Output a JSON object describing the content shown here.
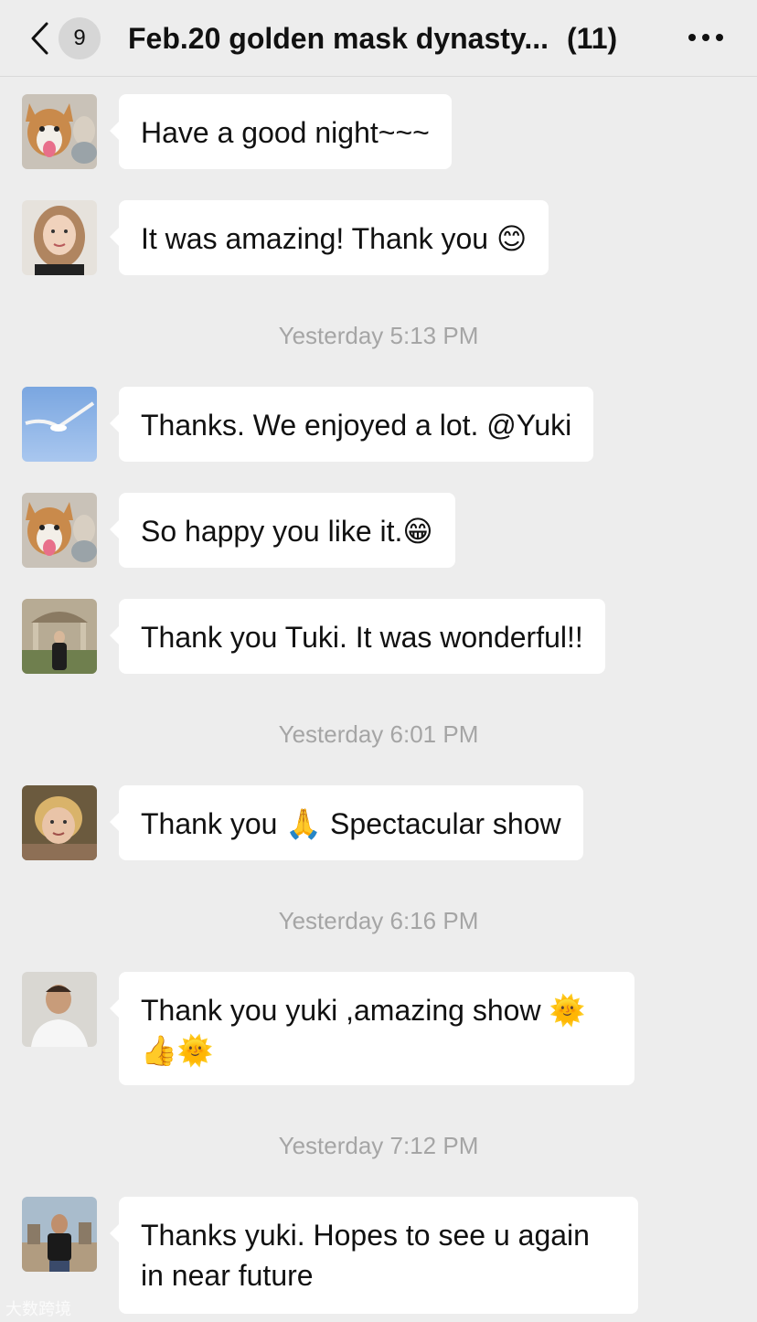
{
  "header": {
    "unread_count": "9",
    "title": "Feb.20 golden mask dynasty...",
    "member_count": "(11)"
  },
  "messages": [
    {
      "avatar": "corgi-dog-avatar",
      "text": "Have a good night~~~",
      "emoji": ""
    },
    {
      "avatar": "woman-portrait-avatar",
      "text": "It was amazing! Thank you ",
      "emoji": "😊"
    },
    {
      "avatar": "seagull-sky-avatar",
      "text": "Thanks. We enjoyed a lot. @Yuki",
      "emoji": ""
    },
    {
      "avatar": "corgi-dog-avatar",
      "text": "So happy you like it.",
      "emoji": "😁"
    },
    {
      "avatar": "person-pavilion-avatar",
      "text": "Thank you Tuki. It was wonderful!!",
      "emoji": ""
    },
    {
      "avatar": "elderly-woman-avatar",
      "text_before": "Thank you ",
      "emoji": "🙏",
      "text_after": " Spectacular show"
    },
    {
      "avatar": "man-white-shirt-avatar",
      "text": "Thank you yuki ,amazing show ",
      "emoji": "🌞",
      "line2_emoji": "👍🌞"
    },
    {
      "avatar": "man-black-tshirt-avatar",
      "text": "Thanks yuki. Hopes to see u again in near future",
      "emoji": ""
    }
  ],
  "timestamps": [
    "Yesterday 5:13 PM",
    "Yesterday 6:01 PM",
    "Yesterday 6:16 PM",
    "Yesterday 7:12 PM"
  ],
  "watermark": "大数跨境"
}
